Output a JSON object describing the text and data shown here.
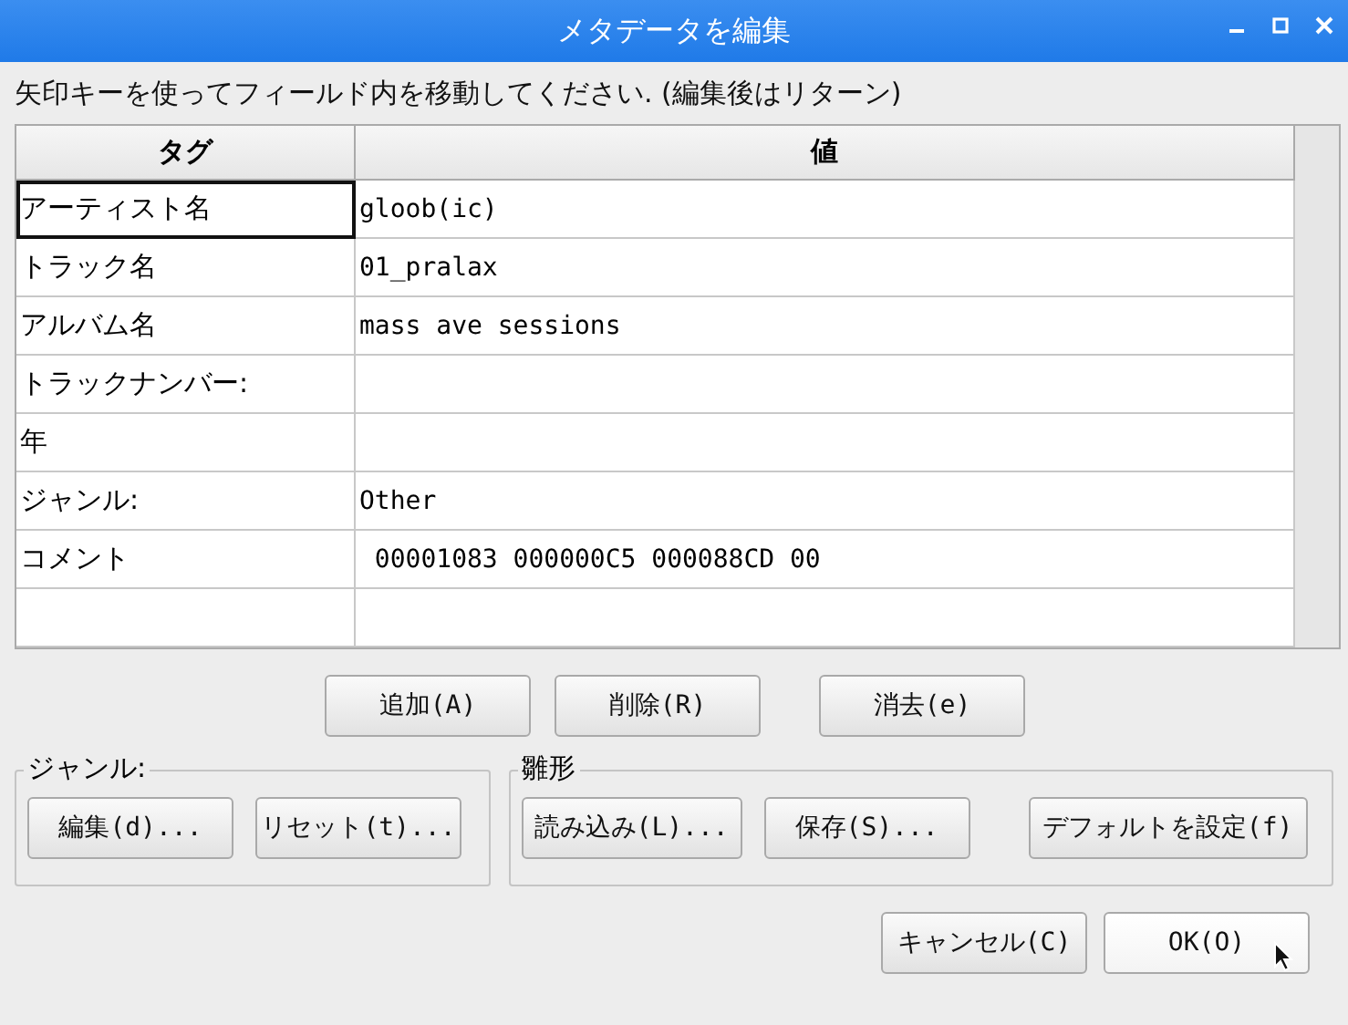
{
  "window": {
    "title": "メタデータを編集"
  },
  "instruction": "矢印キーを使ってフィールド内を移動してください. (編集後はリターン)",
  "table": {
    "columns": [
      "タグ",
      "値"
    ],
    "rows": [
      {
        "tag": "アーティスト名",
        "value": "gloob(ic)",
        "focused": true
      },
      {
        "tag": "トラック名",
        "value": "01_pralax",
        "focused": false
      },
      {
        "tag": "アルバム名",
        "value": "mass ave sessions",
        "focused": false
      },
      {
        "tag": "トラックナンバー:",
        "value": "",
        "focused": false
      },
      {
        "tag": "年",
        "value": "",
        "focused": false
      },
      {
        "tag": "ジャンル:",
        "value": "Other",
        "focused": false
      },
      {
        "tag": "コメント",
        "value": " 00001083 000000C5 000088CD 00",
        "focused": false
      },
      {
        "tag": "",
        "value": "",
        "focused": false
      }
    ]
  },
  "row_buttons": [
    "追加(A)",
    "削除(R)",
    "消去(e)"
  ],
  "genre_group": {
    "label": "ジャンル:",
    "buttons": [
      "編集(d)...",
      "リセット(t)..."
    ]
  },
  "template_group": {
    "label": "雛形",
    "buttons": [
      "読み込み(L)...",
      "保存(S)...",
      "デフォルトを設定(f)"
    ]
  },
  "dialog_buttons": [
    {
      "label": "キャンセル(C)",
      "default": false
    },
    {
      "label": "OK(O)",
      "default": true
    }
  ]
}
